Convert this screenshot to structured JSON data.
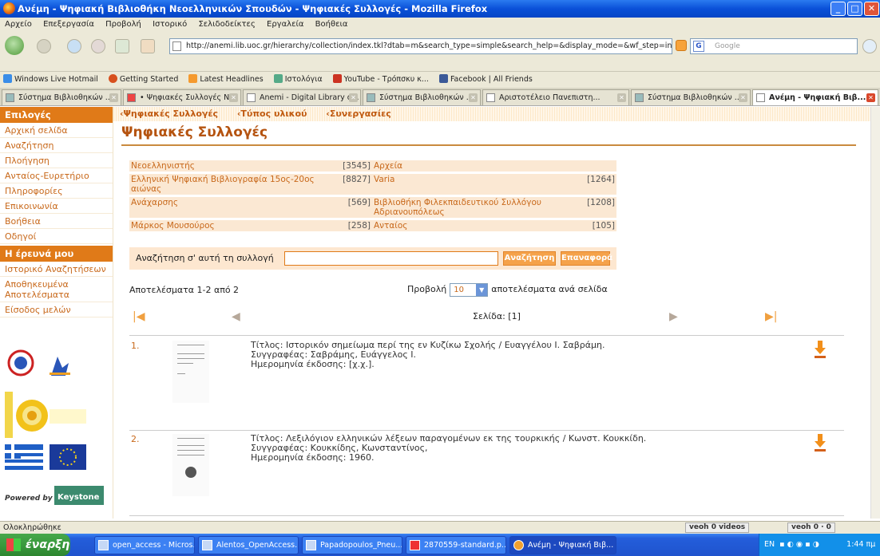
{
  "window": {
    "title": "Ανέμη - Ψηφιακή Βιβλιοθήκη Νεοελληνικών Σπουδών - Ψηφιακές Συλλογές - Mozilla Firefox",
    "min": "_",
    "max": "□",
    "close": "✕"
  },
  "menu": [
    "Αρχείο",
    "Επεξεργασία",
    "Προβολή",
    "Ιστορικό",
    "Σελιδοδείκτες",
    "Εργαλεία",
    "Βοήθεια"
  ],
  "nav": {
    "url": "http://anemi.lib.uoc.gr/hierarchy/collection/index.tkl?dtab=m&search_type=simple&search_help=&display_mode=&wf_step=init&show",
    "search_placeholder": "Google"
  },
  "bookmarks": [
    "Windows Live Hotmail",
    "Getting Started",
    "Latest Headlines",
    "Ιστολόγια",
    "YouTube - Τρόπσκυ κ...",
    "Facebook | All Friends"
  ],
  "tabs": [
    {
      "label": "Σύστημα Βιβλιοθηκών ..."
    },
    {
      "label": "• Ψηφιακές Συλλογές Ν..."
    },
    {
      "label": "Anemi - Digital Library o..."
    },
    {
      "label": "Σύστημα Βιβλιοθηκών ..."
    },
    {
      "label": "Αριστοτέλειο Πανεπιστη..."
    },
    {
      "label": "Σύστημα Βιβλιοθηκών ..."
    },
    {
      "label": "Ανέμη - Ψηφιακή Βιβ..."
    }
  ],
  "sidebar": {
    "options_header": "Επιλογές",
    "options": [
      "Αρχική σελίδα",
      "Αναζήτηση",
      "Πλοήγηση",
      "Ανταίος-Ευρετήριο",
      "Πληροφορίες",
      "Επικοινωνία",
      "Βοήθεια",
      "Οδηγοί"
    ],
    "myarea_header": "Η έρευνά μου",
    "myarea": [
      "Ιστορικό Αναζητήσεων",
      "Αποθηκευμένα Αποτελέσματα",
      "Είσοδος μελών"
    ],
    "powered_by": "Powered by",
    "powered_brand": "Keystone"
  },
  "topnav": [
    "Ψηφιακές Συλλογές",
    "Τύπος υλικού",
    "Συνεργασίες"
  ],
  "page_title": "Ψηφιακές Συλλογές",
  "collections": [
    {
      "left": "Νεοελληνιστής",
      "left_count": "[3545]",
      "right": "Αρχεία",
      "right_count": ""
    },
    {
      "left": "Ελληνική Ψηφιακή Βιβλιογραφία 15ος-20ος αιώνας",
      "left_count": "[8827]",
      "right": "Varia",
      "right_count": "[1264]"
    },
    {
      "left": "Ανάχαρσης",
      "left_count": "[569]",
      "right": "Βιβλιοθήκη Φιλεκπαιδευτικού Συλλόγου Αδριανουπόλεως",
      "right_count": "[1208]"
    },
    {
      "left": "Μάρκος Μουσούρος",
      "left_count": "[258]",
      "right": "Ανταίος",
      "right_count": "[105]"
    }
  ],
  "search": {
    "label": "Αναζήτηση σ' αυτή τη συλλογή",
    "value": "",
    "submit": "Αναζήτηση",
    "reset": "Επαναφορά"
  },
  "results_summary": "Αποτελέσματα 1-2 από 2",
  "view": {
    "prefix": "Προβολή",
    "selected": "10",
    "suffix": "αποτελέσματα ανά σελίδα"
  },
  "pager": {
    "page_label": "Σελίδα: [1]"
  },
  "records": [
    {
      "num": "1.",
      "title": "Τίτλος: Ιστορικόν σημείωμα περί της εν Κυζίκω Σχολής / Ευαγγέλου Ι. Σαβράμη.",
      "author": "Συγγραφέας: Σαβράμης, Ευάγγελος Ι.",
      "date": "Ημερομηνία έκδοσης: [χ.χ.]."
    },
    {
      "num": "2.",
      "title": "Τίτλος: Λεξιλόγιον ελληνικών λέξεων παραγομένων εκ της τουρκικής / Κωνστ. Κουκκίδη.",
      "author": "Συγγραφέας: Κουκκίδης, Κωνσταντίνος,",
      "date": "Ημερομηνία έκδοσης: 1960."
    }
  ],
  "status": "Ολοκληρώθηκε",
  "veoh": [
    "veoh  0 videos",
    "veoh  0 ⋅ 0"
  ],
  "taskbar": {
    "start": "έναρξη",
    "tasks": [
      "open_access - Micros...",
      "Alentos_OpenAccess...",
      "Papadopoulos_Pneu...",
      "2870559-standard.p...",
      "Ανέμη - Ψηφιακή Βιβ..."
    ],
    "tray_lang": "EN",
    "clock": "1:44 πμ"
  },
  "colors": {
    "accent": "#e07a18",
    "link": "#c8681a",
    "title": "#b5530f",
    "rowbg": "#fbe8d3"
  }
}
